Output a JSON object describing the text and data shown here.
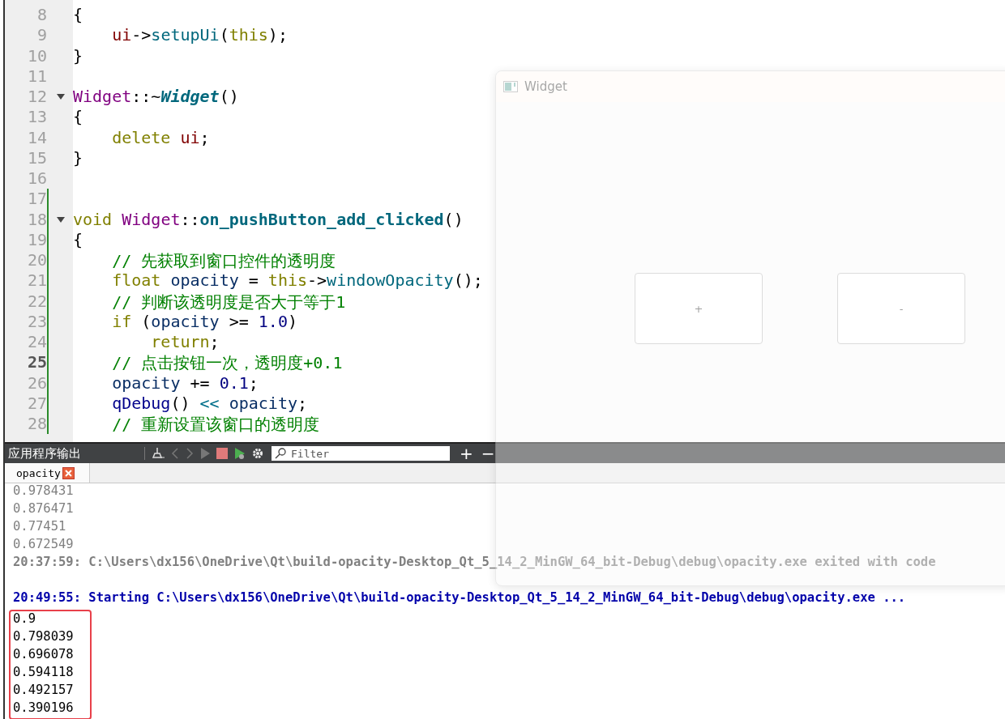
{
  "editor": {
    "lines": [
      {
        "number": "8",
        "current": false,
        "foldable": false,
        "changed": false,
        "tokens": [
          {
            "text": "{",
            "kind": "plain"
          }
        ]
      },
      {
        "number": "9",
        "current": false,
        "foldable": false,
        "changed": false,
        "tokens": [
          {
            "text": "    ui",
            "kind": "member"
          },
          {
            "text": "->",
            "kind": "plain"
          },
          {
            "text": "setupUi",
            "kind": "func"
          },
          {
            "text": "(",
            "kind": "plain"
          },
          {
            "text": "this",
            "kind": "keyword"
          },
          {
            "text": ");",
            "kind": "plain"
          }
        ]
      },
      {
        "number": "10",
        "current": false,
        "foldable": false,
        "changed": false,
        "tokens": [
          {
            "text": "}",
            "kind": "plain"
          }
        ]
      },
      {
        "number": "11",
        "current": false,
        "foldable": false,
        "changed": false
      },
      {
        "number": "12",
        "current": false,
        "foldable": true,
        "changed": false,
        "tokens": [
          {
            "text": "Widget",
            "kind": "type"
          },
          {
            "text": "::~",
            "kind": "plain"
          },
          {
            "text": "Widget",
            "kind": "dtor"
          },
          {
            "text": "()",
            "kind": "plain"
          }
        ]
      },
      {
        "number": "13",
        "current": false,
        "foldable": false,
        "changed": false,
        "tokens": [
          {
            "text": "{",
            "kind": "plain"
          }
        ]
      },
      {
        "number": "14",
        "current": false,
        "foldable": false,
        "changed": false,
        "tokens": [
          {
            "text": "    delete",
            "kind": "keyword"
          },
          {
            "text": " ui",
            "kind": "member"
          },
          {
            "text": ";",
            "kind": "plain"
          }
        ]
      },
      {
        "number": "15",
        "current": false,
        "foldable": false,
        "changed": false,
        "tokens": [
          {
            "text": "}",
            "kind": "plain"
          }
        ]
      },
      {
        "number": "16",
        "current": false,
        "foldable": false,
        "changed": false
      },
      {
        "number": "17",
        "current": false,
        "foldable": false,
        "changed": true
      },
      {
        "number": "18",
        "current": false,
        "foldable": true,
        "changed": true,
        "tokens": [
          {
            "text": "void ",
            "kind": "keyword"
          },
          {
            "text": "Widget",
            "kind": "type"
          },
          {
            "text": "::",
            "kind": "plain"
          },
          {
            "text": "on_pushButton_add_clicked",
            "kind": "funcdecl"
          },
          {
            "text": "()",
            "kind": "plain"
          }
        ]
      },
      {
        "number": "19",
        "current": false,
        "foldable": false,
        "changed": true,
        "tokens": [
          {
            "text": "{",
            "kind": "plain"
          }
        ]
      },
      {
        "number": "20",
        "current": false,
        "foldable": false,
        "changed": true,
        "tokens": [
          {
            "text": "    // 先获取到窗口控件的透明度",
            "kind": "comment"
          }
        ]
      },
      {
        "number": "21",
        "current": false,
        "foldable": false,
        "changed": true,
        "tokens": [
          {
            "text": "    float ",
            "kind": "keyword"
          },
          {
            "text": "opacity",
            "kind": "local"
          },
          {
            "text": " = ",
            "kind": "plain"
          },
          {
            "text": "this",
            "kind": "keyword"
          },
          {
            "text": "->",
            "kind": "plain"
          },
          {
            "text": "windowOpacity",
            "kind": "func"
          },
          {
            "text": "();",
            "kind": "plain"
          }
        ]
      },
      {
        "number": "22",
        "current": false,
        "foldable": false,
        "changed": true,
        "tokens": [
          {
            "text": "    // 判断该透明度是否大于等于1",
            "kind": "comment"
          }
        ]
      },
      {
        "number": "23",
        "current": false,
        "foldable": false,
        "changed": true,
        "tokens": [
          {
            "text": "    if",
            "kind": "keyword"
          },
          {
            "text": " (",
            "kind": "plain"
          },
          {
            "text": "opacity",
            "kind": "local"
          },
          {
            "text": " >= ",
            "kind": "plain"
          },
          {
            "text": "1.0",
            "kind": "number"
          },
          {
            "text": ")",
            "kind": "plain"
          }
        ]
      },
      {
        "number": "24",
        "current": false,
        "foldable": false,
        "changed": true,
        "tokens": [
          {
            "text": "        return",
            "kind": "keyword"
          },
          {
            "text": ";",
            "kind": "plain"
          }
        ]
      },
      {
        "number": "25",
        "current": true,
        "foldable": false,
        "changed": true,
        "tokens": [
          {
            "text": "    // 点击按钮一次，透明度+0.1",
            "kind": "comment"
          }
        ]
      },
      {
        "number": "26",
        "current": false,
        "foldable": false,
        "changed": true,
        "tokens": [
          {
            "text": "    opacity",
            "kind": "local"
          },
          {
            "text": " += ",
            "kind": "plain"
          },
          {
            "text": "0.1",
            "kind": "number"
          },
          {
            "text": ";",
            "kind": "plain"
          }
        ]
      },
      {
        "number": "27",
        "current": false,
        "foldable": false,
        "changed": true,
        "tokens": [
          {
            "text": "    qDebug",
            "kind": "macro"
          },
          {
            "text": "() ",
            "kind": "plain"
          },
          {
            "text": "<< ",
            "kind": "operator"
          },
          {
            "text": "opacity",
            "kind": "local"
          },
          {
            "text": ";",
            "kind": "plain"
          }
        ]
      },
      {
        "number": "28",
        "current": false,
        "foldable": false,
        "changed": true,
        "tokens": [
          {
            "text": "    // 重新设置该窗口的透明度",
            "kind": "comment"
          }
        ]
      }
    ]
  },
  "output_pane": {
    "title": "应用程序输出",
    "filter": {
      "placeholder": "Filter"
    },
    "buttons": [
      "+",
      "−"
    ],
    "tabs": [
      {
        "label": "opacity",
        "selected": true
      }
    ],
    "lines": [
      {
        "text": "0.978431",
        "kind": "old",
        "highlighted": false
      },
      {
        "text": "0.876471",
        "kind": "old",
        "highlighted": false
      },
      {
        "text": "0.77451",
        "kind": "old",
        "highlighted": false
      },
      {
        "text": "0.672549",
        "kind": "old",
        "highlighted": false
      },
      {
        "text": "20:37:59: C:\\Users\\dx156\\OneDrive\\Qt\\build-opacity-Desktop_Qt_5_14_2_MinGW_64_bit-Debug\\debug\\opacity.exe exited with code",
        "kind": "exit",
        "highlighted": false
      },
      {
        "text": "20:49:55: Starting C:\\Users\\dx156\\OneDrive\\Qt\\build-opacity-Desktop_Qt_5_14_2_MinGW_64_bit-Debug\\debug\\opacity.exe ...",
        "kind": "start",
        "highlighted": false
      },
      {
        "text": "0.9",
        "kind": "out",
        "highlighted": true
      },
      {
        "text": "0.798039",
        "kind": "out",
        "highlighted": true
      },
      {
        "text": "0.696078",
        "kind": "out",
        "highlighted": true
      },
      {
        "text": "0.594118",
        "kind": "out",
        "highlighted": true
      },
      {
        "text": "0.492157",
        "kind": "out",
        "highlighted": true
      },
      {
        "text": "0.390196",
        "kind": "out",
        "highlighted": true
      }
    ]
  },
  "widget_window": {
    "title": "Widget",
    "buttons": [
      "+",
      "-"
    ]
  }
}
